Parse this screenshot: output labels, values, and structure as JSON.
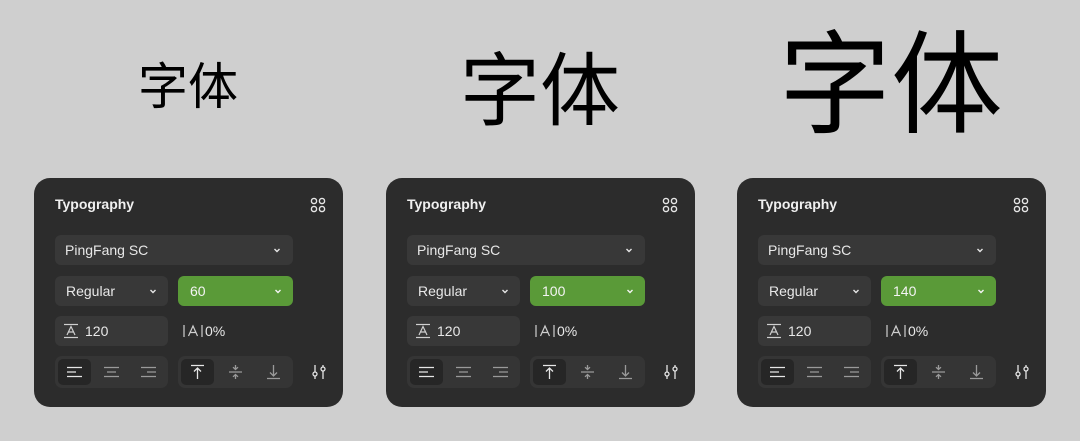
{
  "samples": [
    {
      "text": "字体"
    },
    {
      "text": "字体"
    },
    {
      "text": "字体"
    }
  ],
  "panels": [
    {
      "title": "Typography",
      "font_family": "PingFang SC",
      "font_weight": "Regular",
      "font_size": "60",
      "line_height": "120",
      "letter_spacing": "0%"
    },
    {
      "title": "Typography",
      "font_family": "PingFang SC",
      "font_weight": "Regular",
      "font_size": "100",
      "line_height": "120",
      "letter_spacing": "0%"
    },
    {
      "title": "Typography",
      "font_family": "PingFang SC",
      "font_weight": "Regular",
      "font_size": "140",
      "line_height": "120",
      "letter_spacing": "0%"
    }
  ],
  "colors": {
    "background": "#cfcfcf",
    "panel": "#2c2c2c",
    "field": "#383838",
    "accent": "#5a9a38"
  },
  "icons": {
    "panel_menu": "four-dots-grid-icon",
    "dropdown": "chevron-down-icon",
    "line_height": "line-height-icon",
    "letter_spacing": "letter-spacing-icon",
    "align_left": "align-left-icon",
    "align_center": "align-center-icon",
    "align_right": "align-right-icon",
    "valign_top": "align-top-icon",
    "valign_middle": "align-middle-icon",
    "valign_bottom": "align-bottom-icon",
    "settings": "sliders-icon"
  },
  "active_state": {
    "horizontal_align": "left",
    "vertical_align": "top"
  }
}
